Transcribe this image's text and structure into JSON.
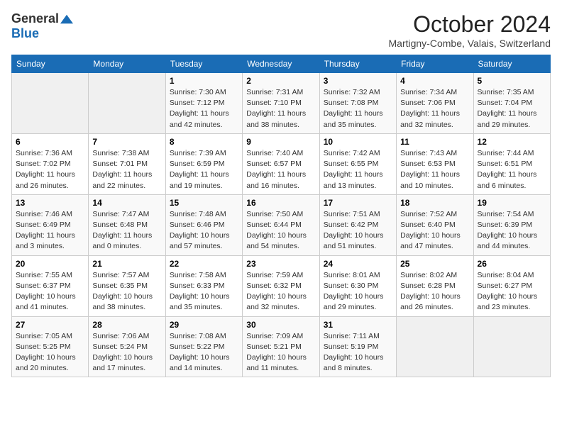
{
  "logo": {
    "general": "General",
    "blue": "Blue"
  },
  "title": "October 2024",
  "location": "Martigny-Combe, Valais, Switzerland",
  "days_of_week": [
    "Sunday",
    "Monday",
    "Tuesday",
    "Wednesday",
    "Thursday",
    "Friday",
    "Saturday"
  ],
  "weeks": [
    [
      {
        "day": "",
        "info": ""
      },
      {
        "day": "",
        "info": ""
      },
      {
        "day": "1",
        "info": "Sunrise: 7:30 AM\nSunset: 7:12 PM\nDaylight: 11 hours and 42 minutes."
      },
      {
        "day": "2",
        "info": "Sunrise: 7:31 AM\nSunset: 7:10 PM\nDaylight: 11 hours and 38 minutes."
      },
      {
        "day": "3",
        "info": "Sunrise: 7:32 AM\nSunset: 7:08 PM\nDaylight: 11 hours and 35 minutes."
      },
      {
        "day": "4",
        "info": "Sunrise: 7:34 AM\nSunset: 7:06 PM\nDaylight: 11 hours and 32 minutes."
      },
      {
        "day": "5",
        "info": "Sunrise: 7:35 AM\nSunset: 7:04 PM\nDaylight: 11 hours and 29 minutes."
      }
    ],
    [
      {
        "day": "6",
        "info": "Sunrise: 7:36 AM\nSunset: 7:02 PM\nDaylight: 11 hours and 26 minutes."
      },
      {
        "day": "7",
        "info": "Sunrise: 7:38 AM\nSunset: 7:01 PM\nDaylight: 11 hours and 22 minutes."
      },
      {
        "day": "8",
        "info": "Sunrise: 7:39 AM\nSunset: 6:59 PM\nDaylight: 11 hours and 19 minutes."
      },
      {
        "day": "9",
        "info": "Sunrise: 7:40 AM\nSunset: 6:57 PM\nDaylight: 11 hours and 16 minutes."
      },
      {
        "day": "10",
        "info": "Sunrise: 7:42 AM\nSunset: 6:55 PM\nDaylight: 11 hours and 13 minutes."
      },
      {
        "day": "11",
        "info": "Sunrise: 7:43 AM\nSunset: 6:53 PM\nDaylight: 11 hours and 10 minutes."
      },
      {
        "day": "12",
        "info": "Sunrise: 7:44 AM\nSunset: 6:51 PM\nDaylight: 11 hours and 6 minutes."
      }
    ],
    [
      {
        "day": "13",
        "info": "Sunrise: 7:46 AM\nSunset: 6:49 PM\nDaylight: 11 hours and 3 minutes."
      },
      {
        "day": "14",
        "info": "Sunrise: 7:47 AM\nSunset: 6:48 PM\nDaylight: 11 hours and 0 minutes."
      },
      {
        "day": "15",
        "info": "Sunrise: 7:48 AM\nSunset: 6:46 PM\nDaylight: 10 hours and 57 minutes."
      },
      {
        "day": "16",
        "info": "Sunrise: 7:50 AM\nSunset: 6:44 PM\nDaylight: 10 hours and 54 minutes."
      },
      {
        "day": "17",
        "info": "Sunrise: 7:51 AM\nSunset: 6:42 PM\nDaylight: 10 hours and 51 minutes."
      },
      {
        "day": "18",
        "info": "Sunrise: 7:52 AM\nSunset: 6:40 PM\nDaylight: 10 hours and 47 minutes."
      },
      {
        "day": "19",
        "info": "Sunrise: 7:54 AM\nSunset: 6:39 PM\nDaylight: 10 hours and 44 minutes."
      }
    ],
    [
      {
        "day": "20",
        "info": "Sunrise: 7:55 AM\nSunset: 6:37 PM\nDaylight: 10 hours and 41 minutes."
      },
      {
        "day": "21",
        "info": "Sunrise: 7:57 AM\nSunset: 6:35 PM\nDaylight: 10 hours and 38 minutes."
      },
      {
        "day": "22",
        "info": "Sunrise: 7:58 AM\nSunset: 6:33 PM\nDaylight: 10 hours and 35 minutes."
      },
      {
        "day": "23",
        "info": "Sunrise: 7:59 AM\nSunset: 6:32 PM\nDaylight: 10 hours and 32 minutes."
      },
      {
        "day": "24",
        "info": "Sunrise: 8:01 AM\nSunset: 6:30 PM\nDaylight: 10 hours and 29 minutes."
      },
      {
        "day": "25",
        "info": "Sunrise: 8:02 AM\nSunset: 6:28 PM\nDaylight: 10 hours and 26 minutes."
      },
      {
        "day": "26",
        "info": "Sunrise: 8:04 AM\nSunset: 6:27 PM\nDaylight: 10 hours and 23 minutes."
      }
    ],
    [
      {
        "day": "27",
        "info": "Sunrise: 7:05 AM\nSunset: 5:25 PM\nDaylight: 10 hours and 20 minutes."
      },
      {
        "day": "28",
        "info": "Sunrise: 7:06 AM\nSunset: 5:24 PM\nDaylight: 10 hours and 17 minutes."
      },
      {
        "day": "29",
        "info": "Sunrise: 7:08 AM\nSunset: 5:22 PM\nDaylight: 10 hours and 14 minutes."
      },
      {
        "day": "30",
        "info": "Sunrise: 7:09 AM\nSunset: 5:21 PM\nDaylight: 10 hours and 11 minutes."
      },
      {
        "day": "31",
        "info": "Sunrise: 7:11 AM\nSunset: 5:19 PM\nDaylight: 10 hours and 8 minutes."
      },
      {
        "day": "",
        "info": ""
      },
      {
        "day": "",
        "info": ""
      }
    ]
  ]
}
